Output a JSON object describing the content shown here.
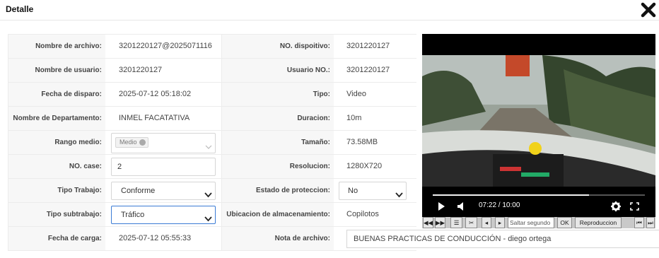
{
  "dialog": {
    "title": "Detalle",
    "close_icon": "close-icon"
  },
  "form": {
    "file_name_label": "Nombre de archivo:",
    "file_name": "3201220127@2025071116",
    "device_no_label": "NO. dispoitivo:",
    "device_no": "3201220127",
    "user_name_label": "Nombre de usuario:",
    "user_name": "3201220127",
    "user_no_label": "Usuario NO.:",
    "user_no": "3201220127",
    "trigger_date_label": "Fecha de disparo:",
    "trigger_date": "2025-07-12 05:18:02",
    "type_label": "Tipo:",
    "type": "Video",
    "department_label": "Nombre de Departamento:",
    "department": "INMEL FACATATIVA",
    "duration_label": "Duracion:",
    "duration": "10m",
    "medium_range_label": "Rango medio:",
    "medium_range_tag": "Medio",
    "size_label": "Tamaño:",
    "size": "73.58MB",
    "case_no_label": "NO. case:",
    "case_no": "2",
    "resolution_label": "Resolucion:",
    "resolution": "1280X720",
    "work_type_label": "Tipo Trabajo:",
    "work_type": "Conforme",
    "protection_label": "Estado de proteccion:",
    "protection": "No",
    "work_subtype_label": "Tipo subtrabajo:",
    "work_subtype": "Tráfico",
    "storage_label": "Ubicacion de almacenamiento:",
    "storage": "Copilotos",
    "upload_date_label": "Fecha de carga:",
    "upload_date": "2025-07-12 05:55:33",
    "note_label": "Nota de archivo:",
    "note": "BUENAS PRACTICAS DE CONDUCCIÓN - diego ortega"
  },
  "player": {
    "time": "07:22 / 10:00",
    "progress": 0.737,
    "skip_placeholder": "Saltar segundo",
    "ok_label": "OK",
    "playback_label": "Reproduccion"
  }
}
